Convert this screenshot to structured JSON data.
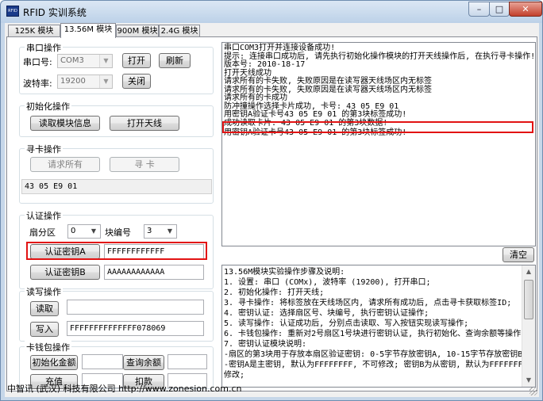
{
  "window": {
    "title": "RFID 实训系统",
    "icon_text": "RFID",
    "minimize_glyph": "–",
    "maximize_glyph": "□",
    "close_glyph": "✕"
  },
  "tabs": [
    "125K 模块",
    "13.56M 模块",
    "900M 模块",
    "2.4G 模块"
  ],
  "serial": {
    "title": "串口操作",
    "port_label": "串口号:",
    "port_value": "COM3",
    "baud_label": "波特率:",
    "baud_value": "19200",
    "open_btn": "打开",
    "refresh_btn": "刷新",
    "close_btn": "关闭"
  },
  "init": {
    "title": "初始化操作",
    "read_info_btn": "读取模块信息",
    "open_antenna_btn": "打开天线"
  },
  "seek": {
    "title": "寻卡操作",
    "request_all_btn": "请求所有",
    "seek_btn": "寻 卡",
    "card_id": "43 05 E9 01"
  },
  "auth": {
    "title": "认证操作",
    "sector_label": "扇分区",
    "sector_value": "0",
    "block_label": "块编号",
    "block_value": "3",
    "key_a_btn": "认证密钥A",
    "key_a_value": "FFFFFFFFFFFF",
    "key_b_btn": "认证密钥B",
    "key_b_value": "AAAAAAAAAAAA"
  },
  "rw": {
    "title": "读写操作",
    "read_btn": "读取",
    "read_value": "",
    "write_btn": "写入",
    "write_value": "FFFFFFFFFFFFFF078069"
  },
  "wallet": {
    "title": "卡钱包操作",
    "init_amount_btn": "初始化金额",
    "query_balance_btn": "查询余额",
    "recharge_btn": "充值",
    "deduct_btn": "扣款"
  },
  "log": {
    "lines": [
      "串口COM3打开并连接设备成功!",
      "提示: 连接串口成功后, 请先执行初始化操作模块的打开天线操作后, 在执行寻卡操作!",
      "版本号: 2010-18-17",
      "打开天线成功",
      "请求所有的卡失败, 失败原因是在读写器天线场区内无标签",
      "请求所有的卡失败, 失败原因是在读写器天线场区内无标签",
      "请求所有的卡成功",
      "防冲撞操作选择卡片成功, 卡号: 43  05  E9  01",
      "用密钥A验证卡号43  05  E9  01  的第3块标签成功!",
      "成功读取卡片: 43  05  E9  01  的第3块数据!",
      "用密钥A验证卡号43  05  E9  01  的第3块标签成功!"
    ],
    "clear_btn": "清空"
  },
  "help": {
    "lines": [
      "13.56M模块实验操作步骤及说明:",
      "1. 设置: 串口 (COMx), 波特率 (19200), 打开串口;",
      "2. 初始化操作: 打开天线;",
      "3. 寻卡操作: 将标签放在天线场区内, 请求所有成功后, 点击寻卡获取标签ID;",
      "4. 密钥认证: 选择扇区号、块编号, 执行密钥认证操作;",
      "5. 读写操作: 认证成功后, 分别点击读取、写入按钮实现读写操作;",
      "6. 卡钱包操作: 重新对2号扇区1号块进行密钥认证, 执行初始化、查询余额等操作;",
      "7. 密钥认证模块说明:",
      "   -扇区的第3块用于存放本扇区验证密钥: 0-5字节存放密钥A, 10-15字节存放密钥B;",
      "   -密钥A是主密钥, 默认为FFFFFFFF, 不可修改; 密钥B为从密钥, 默认为FFFFFFFF, 可以",
      "修改;"
    ]
  },
  "statusbar": {
    "text": "中智讯 (武汉) 科技有限公司 http://www.zonesion.com.cn"
  },
  "colors": {
    "highlight_red": "#e21313",
    "log_bg_highlight": "#ffffff"
  }
}
